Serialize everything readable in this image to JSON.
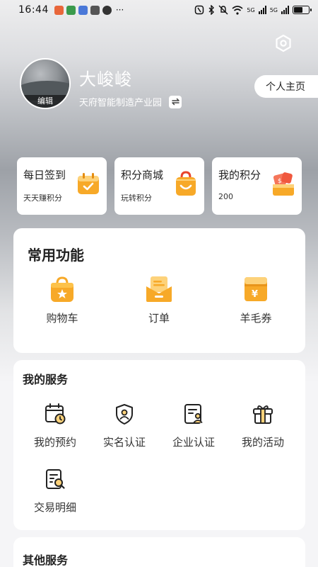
{
  "status_bar": {
    "time": "16:44",
    "dots": "···",
    "net_label_1": "5G",
    "net_label_2": "5G"
  },
  "profile": {
    "name": "大峻峻",
    "edit_label": "编辑",
    "organization": "天府智能制造产业园",
    "home_button": "个人主页"
  },
  "cards": [
    {
      "title": "每日签到",
      "subtitle": "天天赚积分",
      "icon": "calendar-check-icon"
    },
    {
      "title": "积分商城",
      "subtitle": "玩转积分",
      "icon": "shopping-bag-icon"
    },
    {
      "title": "我的积分",
      "subtitle": "200",
      "icon": "coin-box-icon"
    }
  ],
  "common_functions": {
    "title": "常用功能",
    "items": [
      {
        "label": "购物车",
        "icon": "shopping-bag-star-icon"
      },
      {
        "label": "订单",
        "icon": "order-envelope-icon"
      },
      {
        "label": "羊毛券",
        "icon": "coupon-wallet-icon"
      }
    ]
  },
  "my_services": {
    "title": "我的服务",
    "items": [
      {
        "label": "我的预约",
        "icon": "calendar-clock-icon"
      },
      {
        "label": "实名认证",
        "icon": "shield-user-icon"
      },
      {
        "label": "企业认证",
        "icon": "document-user-icon"
      },
      {
        "label": "我的活动",
        "icon": "gift-box-icon"
      },
      {
        "label": "交易明细",
        "icon": "document-search-icon"
      }
    ]
  },
  "other_services": {
    "title": "其他服务"
  },
  "colors": {
    "accent_orange": "#f7a928",
    "accent_light": "#fdd27a",
    "text_dark": "#222222"
  }
}
